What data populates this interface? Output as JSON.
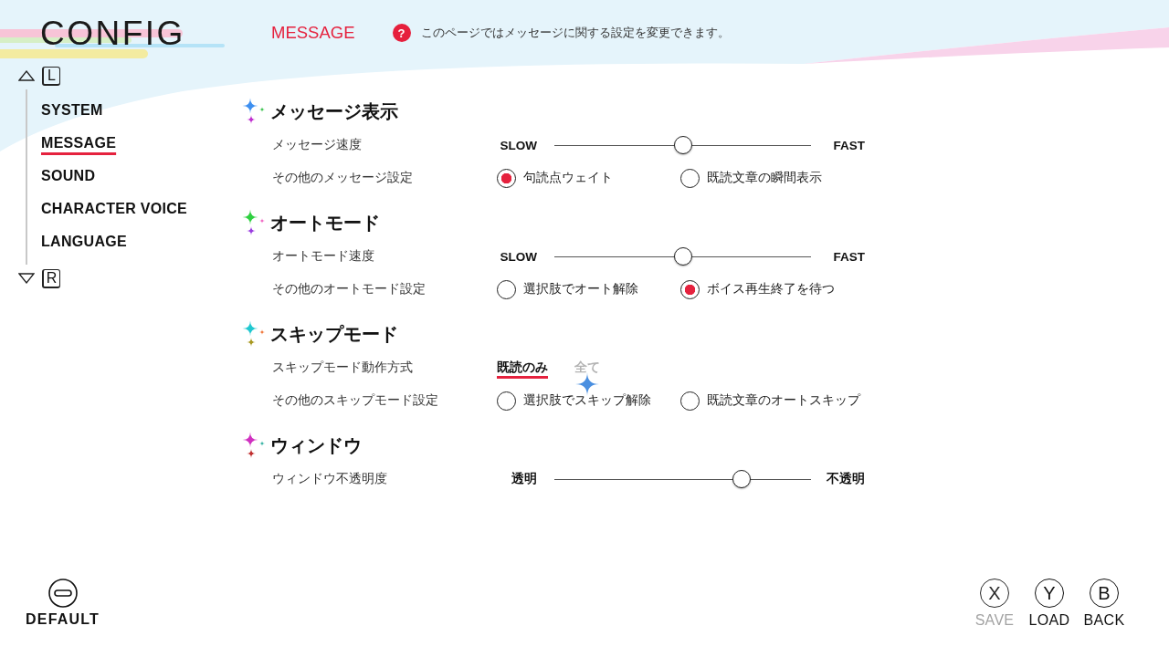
{
  "header": {
    "title": "CONFIG",
    "page": "MESSAGE",
    "help_mark": "?",
    "description": "このページではメッセージに関する設定を変更できます。"
  },
  "sidebar": {
    "prev_key": "L",
    "items": [
      {
        "label": "SYSTEM",
        "selected": false
      },
      {
        "label": "MESSAGE",
        "selected": true
      },
      {
        "label": "SOUND",
        "selected": false
      },
      {
        "label": "CHARACTER VOICE",
        "selected": false
      },
      {
        "label": "LANGUAGE",
        "selected": false
      }
    ],
    "next_key": "R"
  },
  "sections": [
    {
      "title": "メッセージ表示",
      "rows": [
        {
          "kind": "slider",
          "label": "メッセージ速度",
          "min_label": "SLOW",
          "max_label": "FAST",
          "level": 0.5
        },
        {
          "kind": "radio",
          "label": "その他のメッセージ設定",
          "options": [
            {
              "label": "句読点ウェイト",
              "selected": true
            },
            {
              "label": "既読文章の瞬間表示",
              "selected": false
            }
          ]
        }
      ]
    },
    {
      "title": "オートモード",
      "rows": [
        {
          "kind": "slider",
          "label": "オートモード速度",
          "min_label": "SLOW",
          "max_label": "FAST",
          "level": 0.5
        },
        {
          "kind": "radio",
          "label": "その他のオートモード設定",
          "options": [
            {
              "label": "選択肢でオート解除",
              "selected": false
            },
            {
              "label": "ボイス再生終了を待つ",
              "selected": true
            }
          ]
        }
      ]
    },
    {
      "title": "スキップモード",
      "rows": [
        {
          "kind": "choice",
          "label": "スキップモード動作方式",
          "options": [
            {
              "label": "既読のみ",
              "selected": true,
              "focused": false
            },
            {
              "label": "全て",
              "selected": false,
              "focused": true
            }
          ]
        },
        {
          "kind": "radio",
          "label": "その他のスキップモード設定",
          "options": [
            {
              "label": "選択肢でスキップ解除",
              "selected": false
            },
            {
              "label": "既読文章のオートスキップ",
              "selected": false
            }
          ]
        }
      ]
    },
    {
      "title": "ウィンドウ",
      "rows": [
        {
          "kind": "slider",
          "label": "ウィンドウ不透明度",
          "min_label": "透明",
          "max_label": "不透明",
          "level": 0.73
        }
      ]
    }
  ],
  "footer": {
    "default": {
      "label": "DEFAULT"
    },
    "buttons": [
      {
        "key": "X",
        "label": "SAVE",
        "disabled": true
      },
      {
        "key": "Y",
        "label": "LOAD",
        "disabled": false
      },
      {
        "key": "B",
        "label": "BACK",
        "disabled": false
      }
    ]
  }
}
